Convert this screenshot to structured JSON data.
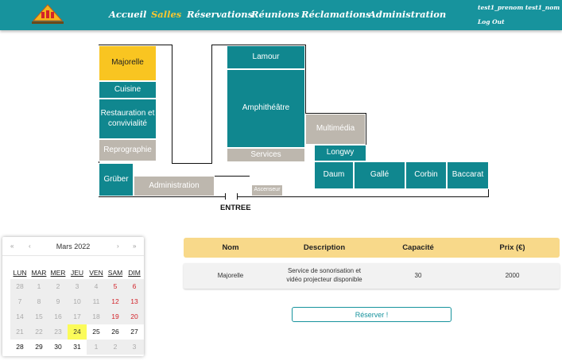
{
  "nav": {
    "links": [
      "Accueil",
      "Salles",
      "Réservations",
      "Réunions",
      "Réclamations",
      "Administration"
    ],
    "active": "Salles",
    "user": "test1_prenom test1_nom",
    "logout": "Log Out"
  },
  "plan": {
    "rooms": {
      "majorelle": "Majorelle",
      "cuisine": "Cuisine",
      "restauration": "Restauration et convivialité",
      "reprographie": "Reprographie",
      "gruber": "Grüber",
      "administration": "Administration",
      "lamour": "Lamour",
      "amphitheatre": "Amphithéâtre",
      "services": "Services",
      "multimedia": "Multimédia",
      "longwy": "Longwy",
      "daum": "Daum",
      "galle": "Gallé",
      "corbin": "Corbin",
      "baccarat": "Baccarat",
      "ascenseur": "Ascenseur"
    },
    "entree": "ENTREE",
    "colors": {
      "teal": "#10878f",
      "gray": "#bdb7ae",
      "selected": "#f9c521"
    }
  },
  "calendar": {
    "month": "Mars 2022",
    "nav": {
      "prev_year": "«",
      "prev": "‹",
      "next": "›",
      "next_year": "»"
    },
    "weekdays": [
      "LUN",
      "MAR",
      "MER",
      "JEU",
      "VEN",
      "SAM",
      "DIM"
    ],
    "weeks": [
      [
        "28",
        "1",
        "2",
        "3",
        "4",
        "5",
        "6"
      ],
      [
        "7",
        "8",
        "9",
        "10",
        "11",
        "12",
        "13"
      ],
      [
        "14",
        "15",
        "16",
        "17",
        "18",
        "19",
        "20"
      ],
      [
        "21",
        "22",
        "23",
        "24",
        "25",
        "26",
        "27"
      ],
      [
        "28",
        "29",
        "30",
        "31",
        "1",
        "2",
        "3"
      ]
    ],
    "today": "24"
  },
  "table": {
    "headers": [
      "Nom",
      "Description",
      "Capacité",
      "Prix (€)"
    ],
    "row": {
      "nom": "Majorelle",
      "description_line1": "Service de sonorisation et",
      "description_line2": "vidéo projecteur disponible",
      "capacite": "30",
      "prix": "2000"
    }
  },
  "reserve_label": "Réserver !"
}
